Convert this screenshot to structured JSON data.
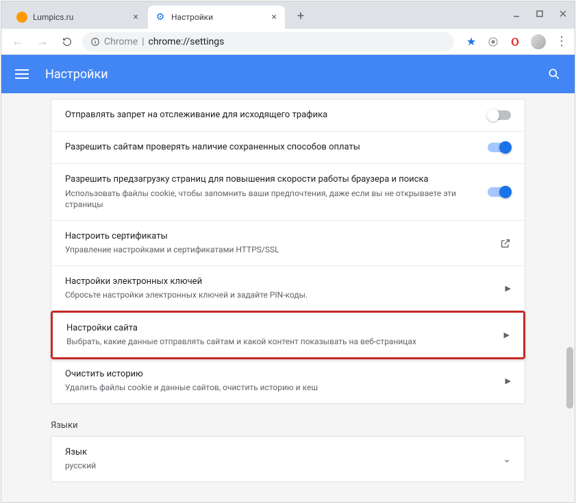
{
  "tabs": [
    {
      "title": "Lumpics.ru",
      "icon": "orange"
    },
    {
      "title": "Настройки",
      "icon": "gear"
    }
  ],
  "url": {
    "prefix": "Chrome",
    "path": "chrome://settings"
  },
  "header": {
    "title": "Настройки"
  },
  "settings": [
    {
      "title": "Отправлять запрет на отслеживание для исходящего трафика",
      "sub": "",
      "control": "toggle-off"
    },
    {
      "title": "Разрешить сайтам проверять наличие сохраненных способов оплаты",
      "sub": "",
      "control": "toggle-on"
    },
    {
      "title": "Разрешить предзагрузку страниц для повышения скорости работы браузера и поиска",
      "sub": "Использовать файлы cookie, чтобы запомнить ваши предпочтения, даже если вы не открываете эти страницы",
      "control": "toggle-on"
    },
    {
      "title": "Настроить сертификаты",
      "sub": "Управление настройками и сертификатами HTTPS/SSL",
      "control": "external"
    },
    {
      "title": "Настройки электронных ключей",
      "sub": "Сбросьте настройки электронных ключей и задайте PIN-коды.",
      "control": "arrow"
    },
    {
      "title": "Настройки сайта",
      "sub": "Выбрать, какие данные отправлять сайтам и какой контент показывать на веб-страницах",
      "control": "arrow",
      "highlight": true
    },
    {
      "title": "Очистить историю",
      "sub": "Удалить файлы cookie и данные сайтов, очистить историю и кеш",
      "control": "arrow"
    }
  ],
  "section_languages": "Языки",
  "language": {
    "title": "Язык",
    "value": "русский"
  }
}
